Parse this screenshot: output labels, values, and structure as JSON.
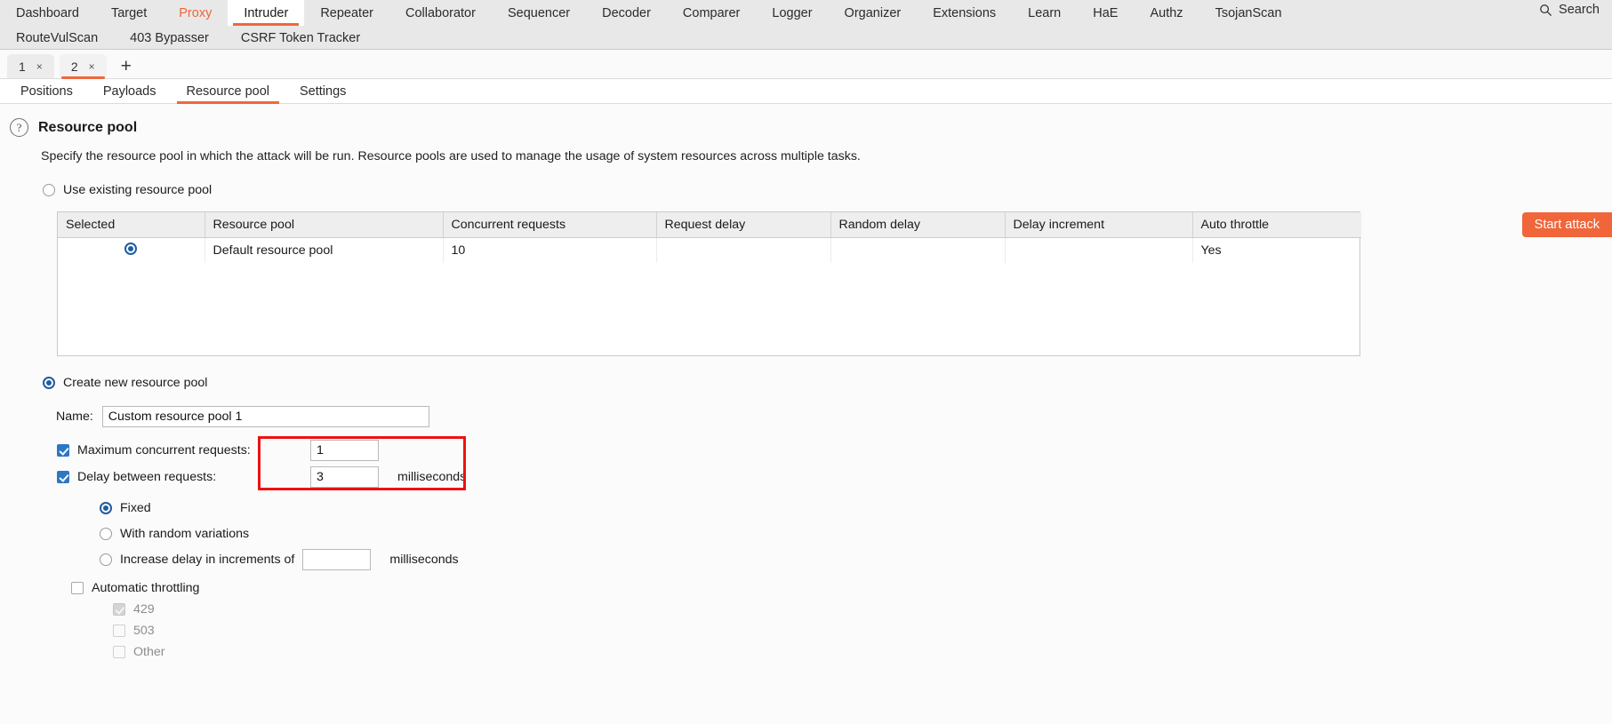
{
  "topnav": {
    "row1": [
      {
        "label": "Dashboard",
        "state": "normal"
      },
      {
        "label": "Target",
        "state": "normal"
      },
      {
        "label": "Proxy",
        "state": "proxy"
      },
      {
        "label": "Intruder",
        "state": "active"
      },
      {
        "label": "Repeater",
        "state": "normal"
      },
      {
        "label": "Collaborator",
        "state": "normal"
      },
      {
        "label": "Sequencer",
        "state": "normal"
      },
      {
        "label": "Decoder",
        "state": "normal"
      },
      {
        "label": "Comparer",
        "state": "normal"
      },
      {
        "label": "Logger",
        "state": "normal"
      },
      {
        "label": "Organizer",
        "state": "normal"
      },
      {
        "label": "Extensions",
        "state": "normal"
      },
      {
        "label": "Learn",
        "state": "normal"
      },
      {
        "label": "HaE",
        "state": "normal"
      },
      {
        "label": "Authz",
        "state": "normal"
      },
      {
        "label": "TsojanScan",
        "state": "normal"
      }
    ],
    "row2": [
      {
        "label": "RouteVulScan"
      },
      {
        "label": "403 Bypasser"
      },
      {
        "label": "CSRF Token Tracker"
      }
    ],
    "search_label": "Search",
    "search_icon": "search-icon"
  },
  "attack_tabs": {
    "tabs": [
      {
        "label": "1",
        "close": "×",
        "active": false
      },
      {
        "label": "2",
        "close": "×",
        "active": true
      }
    ],
    "add_label": "+"
  },
  "subtabs": [
    {
      "label": "Positions",
      "active": false
    },
    {
      "label": "Payloads",
      "active": false
    },
    {
      "label": "Resource pool",
      "active": true
    },
    {
      "label": "Settings",
      "active": false
    }
  ],
  "section": {
    "help_icon": "help-icon",
    "title": "Resource pool",
    "description": "Specify the resource pool in which the attack will be run. Resource pools are used to manage the usage of system resources across multiple tasks."
  },
  "use_existing": {
    "label": "Use existing resource pool",
    "selected": false
  },
  "table": {
    "headers": [
      "Selected",
      "Resource pool",
      "Concurrent requests",
      "Request delay",
      "Random delay",
      "Delay increment",
      "Auto throttle"
    ],
    "rows": [
      {
        "selected": true,
        "resource_pool": "Default resource pool",
        "concurrent_requests": "10",
        "request_delay": "",
        "random_delay": "",
        "delay_increment": "",
        "auto_throttle": "Yes"
      }
    ]
  },
  "create_new": {
    "label": "Create new resource pool",
    "selected": true,
    "name_label": "Name:",
    "name_value": "Custom resource pool 1",
    "max_concurrent": {
      "label": "Maximum concurrent requests:",
      "checked": true,
      "value": "1"
    },
    "delay_between": {
      "label": "Delay between requests:",
      "checked": true,
      "value": "3",
      "unit": "milliseconds"
    },
    "delay_modes": [
      {
        "label": "Fixed",
        "selected": true
      },
      {
        "label": "With random variations",
        "selected": false
      },
      {
        "label": "Increase delay in increments of",
        "selected": false,
        "value": "",
        "unit": "milliseconds"
      }
    ],
    "auto_throttle": {
      "label": "Automatic throttling",
      "checked": false,
      "codes": [
        {
          "label": "429",
          "checked": true,
          "disabled": true
        },
        {
          "label": "503",
          "checked": false,
          "disabled": true
        },
        {
          "label": "Other",
          "checked": false,
          "disabled": true
        }
      ]
    }
  },
  "start_button": {
    "label": "Start attack"
  },
  "colors": {
    "accent": "#f0663a",
    "radio_blue": "#1f5c9e",
    "checkbox_blue": "#2b77c4",
    "annotation_red": "#ee1111"
  }
}
